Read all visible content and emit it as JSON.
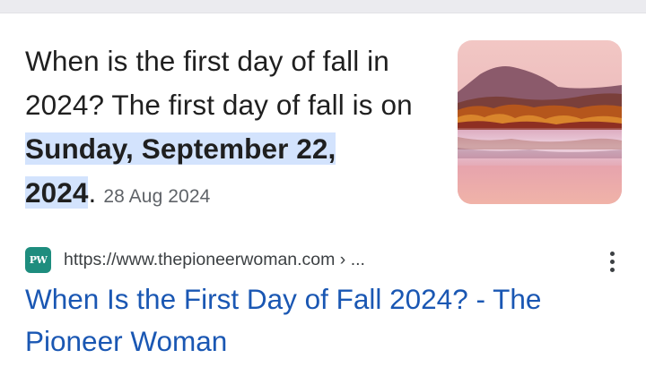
{
  "snippet": {
    "lead_text": "When is the first day of fall in 2024? The first day of fall is on ",
    "highlight_text": "Sunday, September 22, 2024",
    "trailing_text": ".",
    "date": "28 Aug 2024"
  },
  "thumbnail": {
    "icon": "autumn-lake-landscape-image"
  },
  "source": {
    "favicon_text": "PW",
    "url": "https://www.thepioneerwoman.com › ..."
  },
  "result": {
    "title": "When Is the First Day of Fall 2024? - The Pioneer Woman"
  },
  "colors": {
    "highlight": "#d3e3fd",
    "link": "#1a57b3",
    "favicon_bg": "#1e8d7e"
  },
  "menu_icon": "more-vert-icon"
}
